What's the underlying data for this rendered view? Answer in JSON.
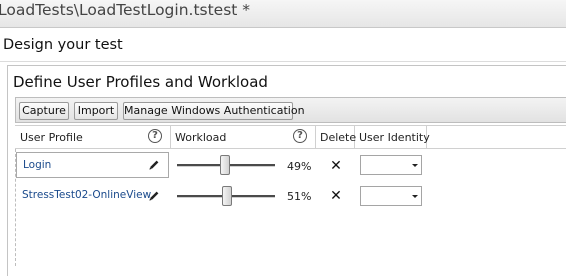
{
  "window": {
    "title": "LoadTests\\LoadTestLogin.tstest *"
  },
  "section": {
    "title": "Design your test"
  },
  "panel": {
    "title": "Define User Profiles and Workload"
  },
  "toolbar": {
    "capture_label": "Capture",
    "import_label": "Import",
    "manage_auth_label": "Manage Windows Authentication"
  },
  "grid": {
    "columns": {
      "user_profile": "User Profile",
      "workload": "Workload",
      "delete": "Delete",
      "user_identity": "User Identity"
    },
    "help_glyph": "?",
    "rows": [
      {
        "name": "Login",
        "workload": 49,
        "workload_label": "49%",
        "delete_glyph": "✕",
        "identity": "",
        "selected": true
      },
      {
        "name": "StressTest02-OnlineView",
        "workload": 51,
        "workload_label": "51%",
        "delete_glyph": "✕",
        "identity": "",
        "selected": false
      }
    ]
  },
  "icons": {
    "help": "help-circle-icon",
    "edit": "pencil-icon",
    "delete": "close-icon",
    "dropdown": "chevron-down-icon"
  }
}
